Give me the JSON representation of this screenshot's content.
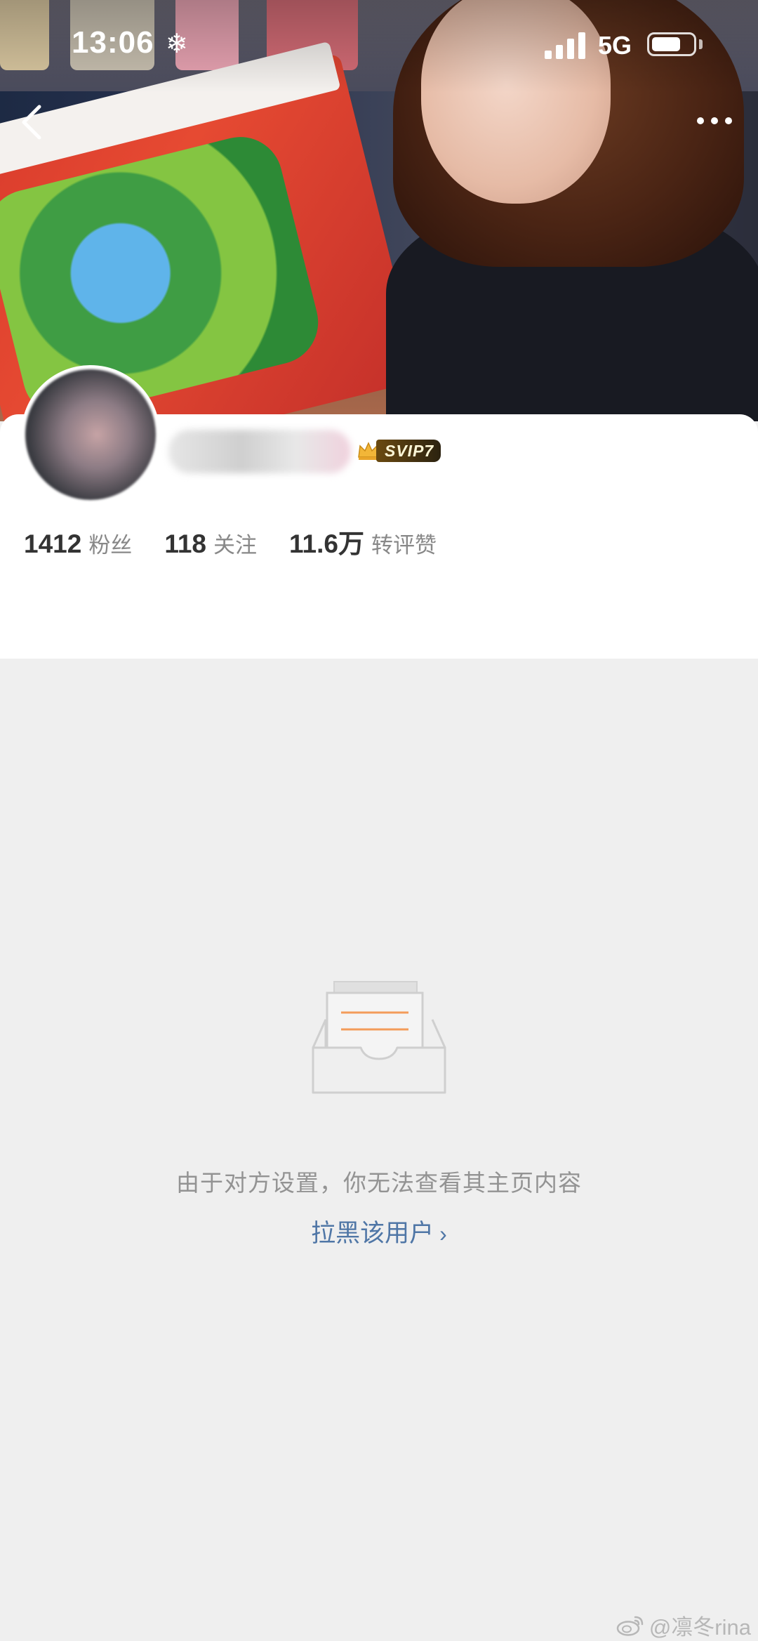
{
  "status_bar": {
    "time": "13:06",
    "network": "5G",
    "icons": [
      "snowflake-icon",
      "signal-icon",
      "battery-icon"
    ]
  },
  "nav": {
    "back_icon": "back-arrow-icon",
    "more_icon": "more-dots-icon"
  },
  "profile": {
    "username": "",
    "vip_badge": "SVIP7",
    "stats": [
      {
        "value": "1412",
        "label": "粉丝"
      },
      {
        "value": "118",
        "label": "关注"
      },
      {
        "value": "11.6万",
        "label": "转评赞"
      }
    ]
  },
  "empty_state": {
    "message": "由于对方设置，你无法查看其主页内容",
    "block_link": "拉黑该用户"
  },
  "watermark": {
    "text": "@凛冬rina"
  },
  "colors": {
    "page_bg": "#efefef",
    "link": "#4f76a6",
    "muted_text": "#939393",
    "accent_orange": "#f39c5a"
  }
}
